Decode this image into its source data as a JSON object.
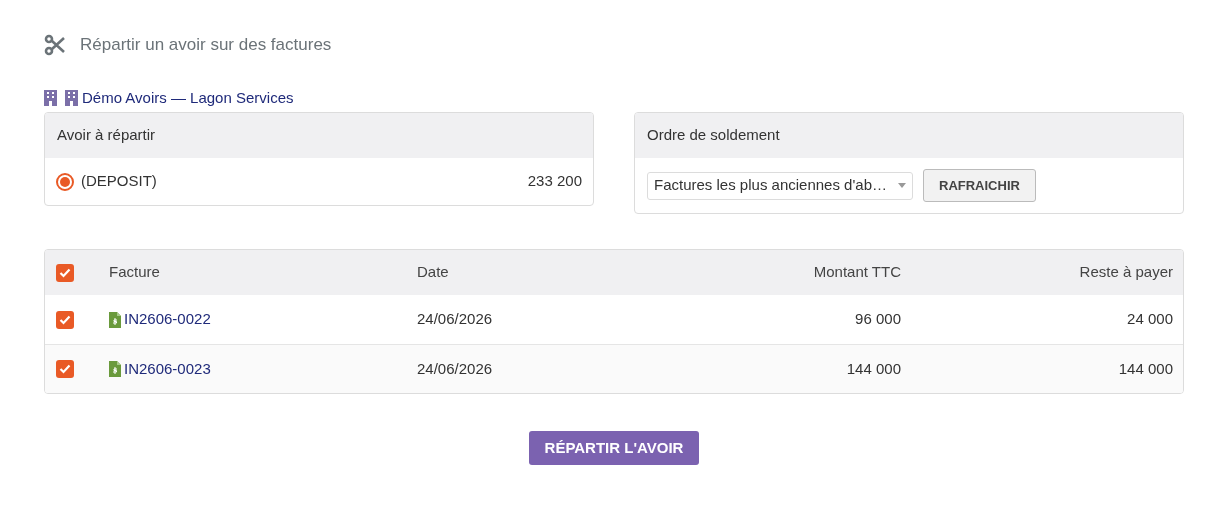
{
  "title": "Répartir un avoir sur des factures",
  "company": {
    "name": "Démo Avoirs — Lagon Services"
  },
  "credit_panel": {
    "heading": "Avoir à répartir",
    "items": [
      {
        "label": "(DEPOSIT)",
        "amount": "233 200",
        "selected": true
      }
    ]
  },
  "order_panel": {
    "heading": "Ordre de soldement",
    "select_value": "Factures les plus anciennes d'ab…",
    "refresh_button": "RAFRAICHIR"
  },
  "table": {
    "all_checked": true,
    "columns": [
      "Facture",
      "Date",
      "Montant TTC",
      "Reste à payer"
    ],
    "rows": [
      {
        "checked": true,
        "invoice": "IN2606-0022",
        "date": "24/06/2026",
        "amount": "96 000",
        "remaining": "24 000"
      },
      {
        "checked": true,
        "invoice": "IN2606-0023",
        "date": "24/06/2026",
        "amount": "144 000",
        "remaining": "144 000"
      }
    ]
  },
  "submit_button": "RÉPARTIR L'AVOIR"
}
